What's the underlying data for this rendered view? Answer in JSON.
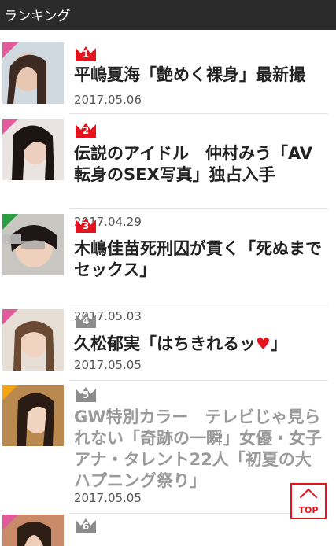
{
  "header": {
    "title": "ランキング"
  },
  "colors": {
    "rank_top": "#e3141e",
    "rank_other": "#8c8c8c",
    "corner_pink": "#e05a9c",
    "corner_green": "#2e9e43",
    "corner_orange": "#f2a413"
  },
  "items": [
    {
      "rank": "1",
      "title": "平嶋夏海「艶めく裸身」最新撮",
      "date": "2017.05.06",
      "corner": "pink"
    },
    {
      "rank": "2",
      "title": "伝説のアイドル　仲村みう「AV転身のSEX写真」独占入手",
      "date": "2017.04.29",
      "corner": "pink"
    },
    {
      "rank": "3",
      "title": "木嶋佳苗死刑囚が貫く「死ぬまでセックス」",
      "date": "2017.05.03",
      "corner": "green"
    },
    {
      "rank": "4",
      "title_prefix": "久松郁実「はちきれるッ",
      "title_heart": "♥",
      "title_suffix": "」",
      "date": "2017.05.05",
      "corner": "pink"
    },
    {
      "rank": "5",
      "title": "GW特別カラー　テレビじゃ見られない「奇跡の一瞬」女優・女子アナ・タレント22人「初夏の大ハプニング祭り」",
      "date": "2017.05.05",
      "corner": "orange"
    },
    {
      "rank": "6",
      "corner": "pink"
    }
  ],
  "top_button": {
    "label": "TOP"
  }
}
